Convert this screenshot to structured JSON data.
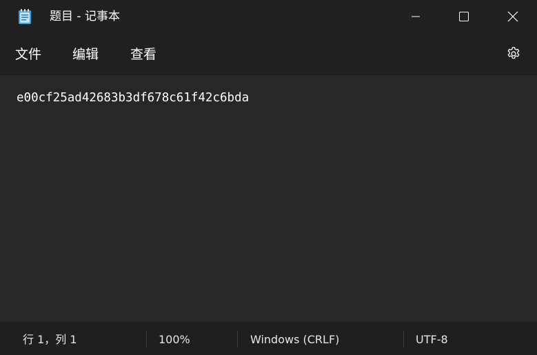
{
  "window": {
    "title": "题目 - 记事本"
  },
  "menu": {
    "file_label": "文件",
    "edit_label": "编辑",
    "view_label": "查看"
  },
  "editor": {
    "content": "e00cf25ad42683b3df678c61f42c6bda"
  },
  "status": {
    "position": "行 1，列 1",
    "zoom": "100%",
    "line_ending": "Windows (CRLF)",
    "encoding": "UTF-8"
  },
  "icons": {
    "app": "notepad-icon",
    "minimize": "minimize-icon",
    "maximize": "maximize-icon",
    "close": "close-icon",
    "settings": "gear-icon"
  },
  "colors": {
    "chrome_background": "#202020",
    "editor_background": "#272727",
    "statusbar_background": "#1f1f1f",
    "text": "#ffffff",
    "app_icon_accent": "#3aa0e0"
  }
}
